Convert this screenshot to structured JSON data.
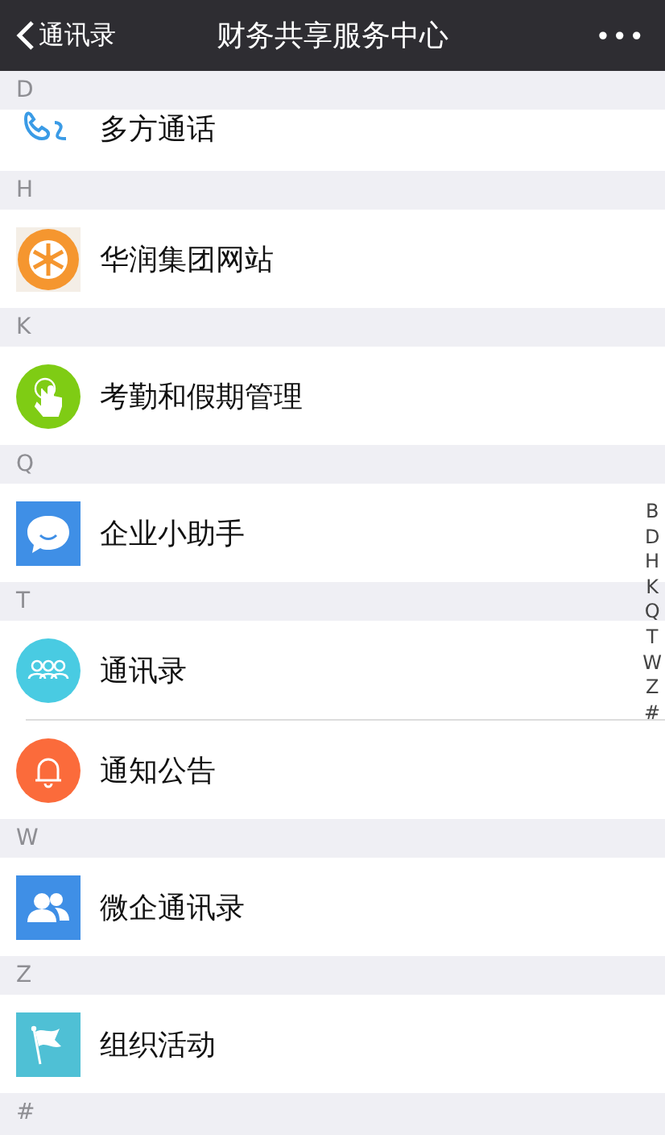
{
  "nav_bar": {
    "back_label": "通讯录",
    "title": "财务共享服务中心",
    "more": "•••"
  },
  "sections": [
    {
      "letter": "D",
      "items": [
        {
          "name": "多方通话",
          "kind": "phone",
          "partial": true
        }
      ]
    },
    {
      "letter": "H",
      "items": [
        {
          "name": "华润集团网站",
          "kind": "emblem",
          "partial": false
        }
      ]
    },
    {
      "letter": "K",
      "items": [
        {
          "name": "考勤和假期管理",
          "kind": "hand",
          "partial": false
        }
      ]
    },
    {
      "letter": "Q",
      "items": [
        {
          "name": "企业小助手",
          "kind": "chat",
          "partial": false
        }
      ]
    },
    {
      "letter": "T",
      "items": [
        {
          "name": "通讯录",
          "kind": "people",
          "partial": false
        },
        {
          "name": "通知公告",
          "kind": "bell",
          "partial": false
        }
      ]
    },
    {
      "letter": "W",
      "items": [
        {
          "name": "微企通讯录",
          "kind": "contacts",
          "partial": false
        }
      ]
    },
    {
      "letter": "Z",
      "items": [
        {
          "name": "组织活动",
          "kind": "flag",
          "partial": false
        }
      ]
    },
    {
      "letter": "#"
    }
  ],
  "index_bar": [
    "B",
    "D",
    "H",
    "K",
    "Q",
    "T",
    "W",
    "Z",
    "#"
  ]
}
